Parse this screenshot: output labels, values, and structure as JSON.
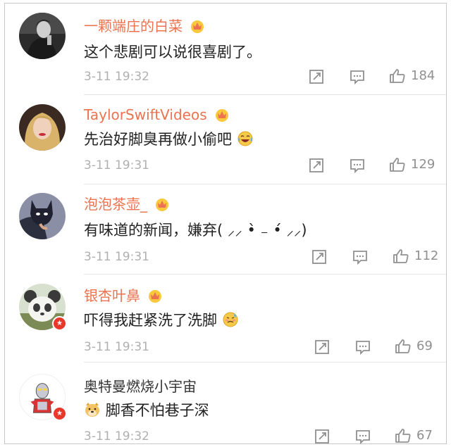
{
  "comments": [
    {
      "username": "一颗端庄的白菜",
      "text": "这个悲剧可以说很喜剧了。",
      "time": "3-11 19:32",
      "likes": "184",
      "verified": false,
      "emoji": null
    },
    {
      "username": "TaylorSwiftVideos",
      "text": "先治好脚臭再做小偷吧",
      "time": "3-11 19:31",
      "likes": "129",
      "verified": false,
      "emoji": "laughing-crying-emoji"
    },
    {
      "username": "泡泡茶壶_",
      "text": "有味道的新闻，嫌弃( ⸝⸝ •̀ ₋ •́ ⸝⸝)",
      "time": "3-11 19:31",
      "likes": "112",
      "verified": false,
      "emoji": null
    },
    {
      "username": "银杏叶鼻",
      "text": "吓得我赶紧洗了洗脚",
      "time": "3-11 19:31",
      "likes": "69",
      "verified": true,
      "emoji": "sweating-emoji"
    },
    {
      "username": "奥特曼燃烧小宇宙",
      "text": "脚香不怕巷子深",
      "time": "3-11 19:32",
      "likes": "67",
      "verified": true,
      "emoji": "doge-emoji"
    }
  ],
  "colors": {
    "username": "#eb7350",
    "text": "#222222",
    "meta": "#b0b0b0",
    "icon": "#909090",
    "badge": "#e8382c"
  }
}
